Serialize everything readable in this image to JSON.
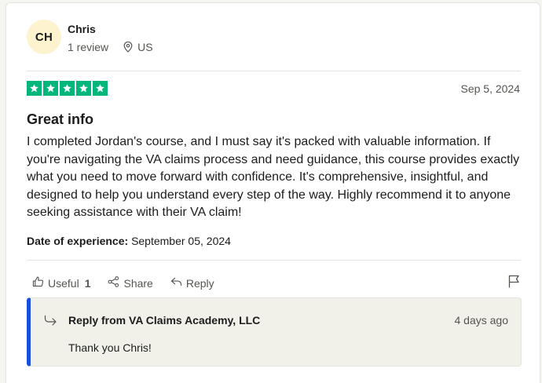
{
  "reviewer": {
    "initials": "CH",
    "name": "Chris",
    "review_count": "1 review",
    "country": "US"
  },
  "review": {
    "rating": 5,
    "date": "Sep 5, 2024",
    "title": "Great info",
    "body": "I completed Jordan's course, and I must say it's packed with valuable information. If you're navigating the VA claims process and need guidance, this course provides exactly what you need to move forward with confidence. It's comprehensive, insightful, and designed to help you understand every step of the way. Highly recommend it to anyone seeking assistance with their VA claim!",
    "experience_label": "Date of experience:",
    "experience_date": "September 05, 2024"
  },
  "actions": {
    "useful_label": "Useful",
    "useful_count": "1",
    "share_label": "Share",
    "reply_label": "Reply"
  },
  "company_reply": {
    "title": "Reply from VA Claims Academy, LLC",
    "date": "4 days ago",
    "text": "Thank you Chris!"
  },
  "colors": {
    "star_green": "#00b67a",
    "reply_accent": "#1c4fd8",
    "avatar_bg": "#fdf4cf"
  }
}
